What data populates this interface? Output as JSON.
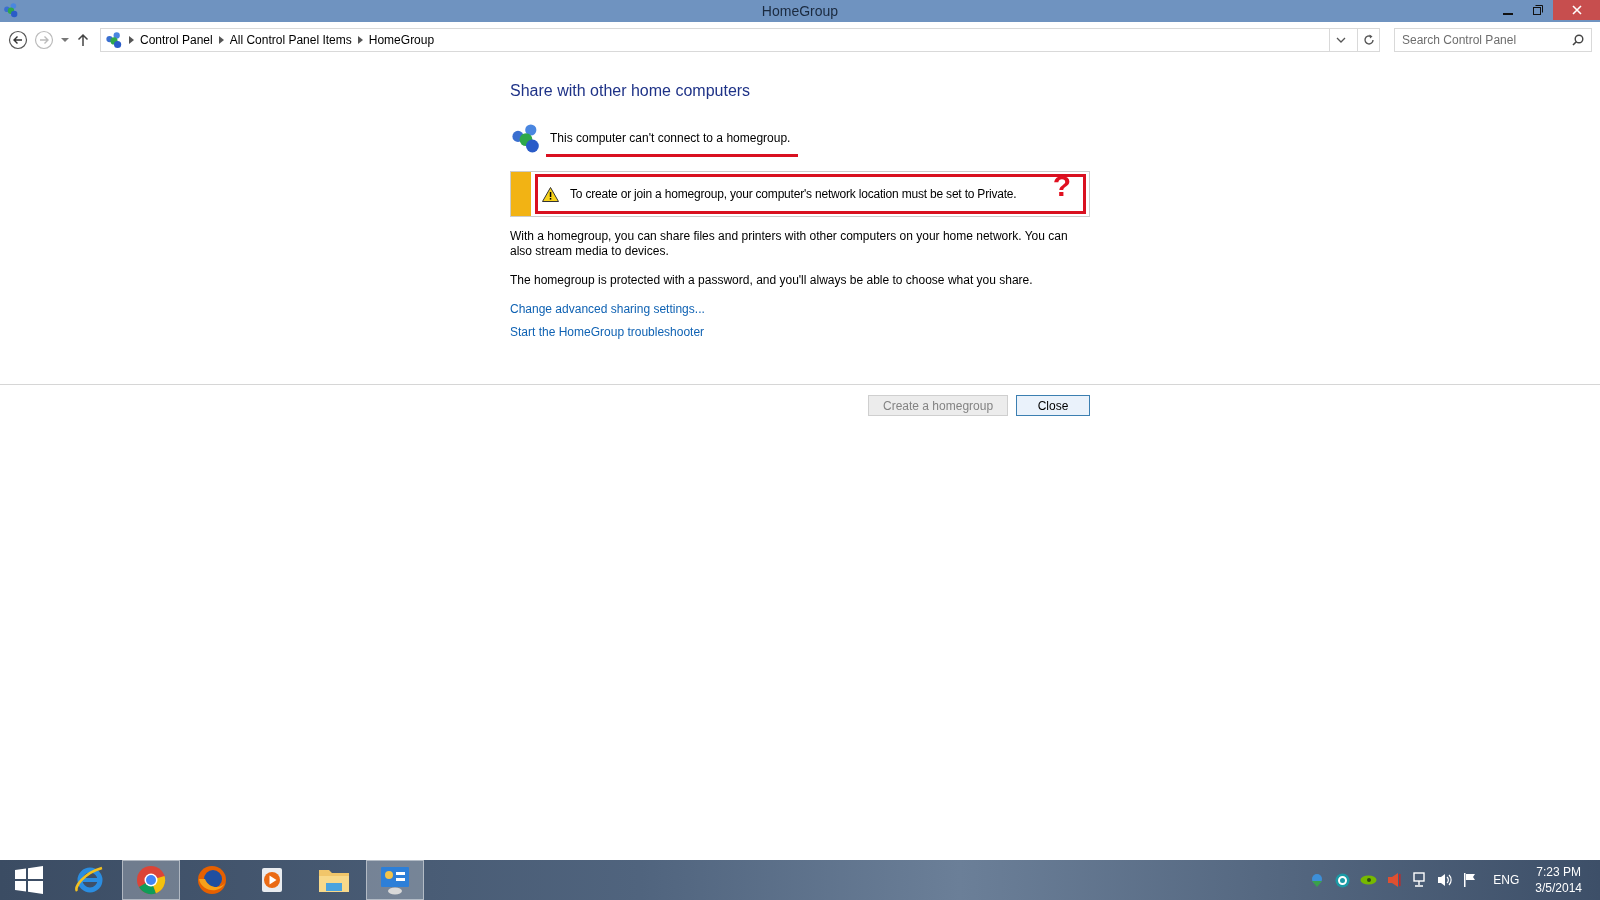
{
  "window": {
    "title": "HomeGroup"
  },
  "address_bar": {
    "breadcrumbs": [
      "Control Panel",
      "All Control Panel Items",
      "HomeGroup"
    ]
  },
  "search": {
    "placeholder": "Search Control Panel"
  },
  "content": {
    "heading": "Share with other home computers",
    "status": "This computer can't connect to a homegroup.",
    "warning": "To create or join a homegroup, your computer's network location must be set to Private.",
    "annotation_mark": "?",
    "paragraphs": [
      "With a homegroup, you can share files and printers with other computers on your home network. You can also stream media to devices.",
      "The homegroup is protected with a password, and you'll always be able to choose what you share."
    ],
    "links": [
      "Change advanced sharing settings...",
      "Start the HomeGroup troubleshooter"
    ]
  },
  "buttons": [
    {
      "label": "Create a homegroup",
      "disabled": true
    },
    {
      "label": "Close",
      "disabled": false
    }
  ],
  "taskbar": {
    "apps": [
      {
        "kind": "start",
        "selected": false
      },
      {
        "kind": "ie",
        "selected": false
      },
      {
        "kind": "chrome",
        "selected": true
      },
      {
        "kind": "firefox",
        "selected": false
      },
      {
        "kind": "media",
        "selected": false
      },
      {
        "kind": "explorer",
        "selected": false
      },
      {
        "kind": "control",
        "selected": true
      }
    ],
    "language": "ENG",
    "time": "7:23 PM",
    "date": "3/5/2014"
  }
}
